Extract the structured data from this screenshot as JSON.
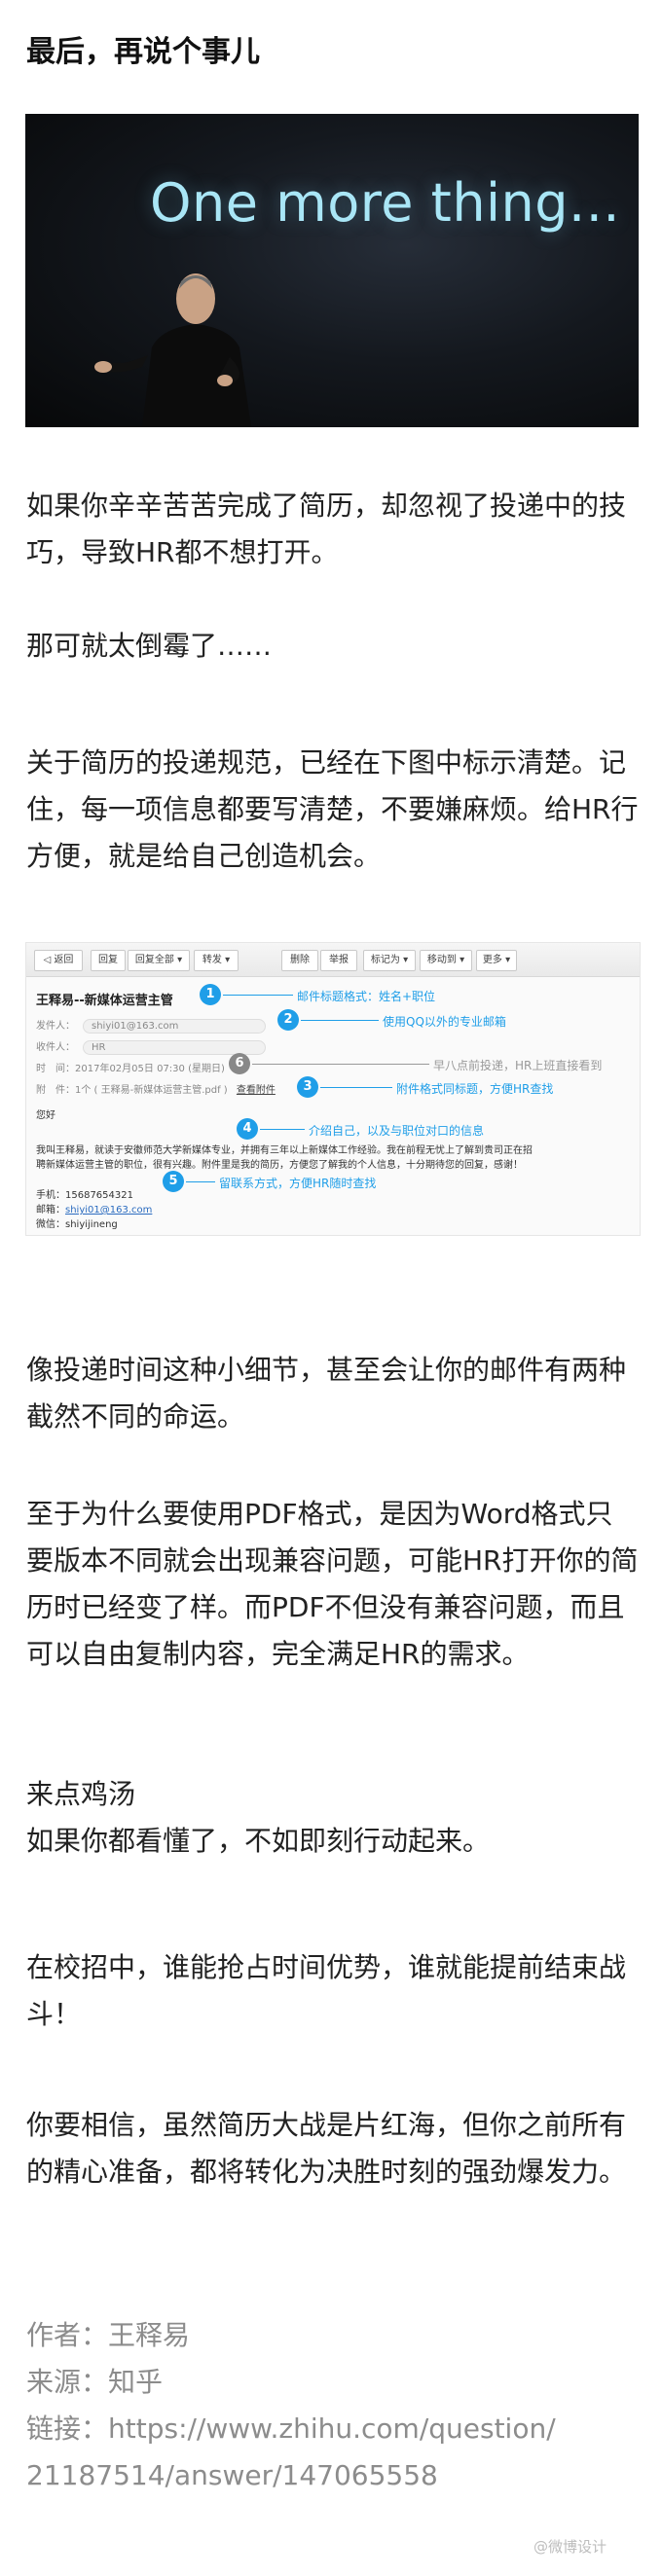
{
  "heading": "最后，再说个事儿",
  "hero": {
    "slide_text": "One more thing..."
  },
  "paragraphs": {
    "p1": "如果你辛辛苦苦完成了简历，却忽视了投递中的技巧，导致HR都不想打开。",
    "p2": "那可就太倒霉了……",
    "p3": "关于简历的投递规范，已经在下图中标示清楚。记住，每一项信息都要写清楚，不要嫌麻烦。给HR行方便，就是给自己创造机会。",
    "p4": "像投递时间这种小细节，甚至会让你的邮件有两种截然不同的命运。",
    "p5": "至于为什么要使用PDF格式，是因为Word格式只要版本不同就会出现兼容问题，可能HR打开你的简历时已经变了样。而PDF不但没有兼容问题，而且可以自由复制内容，完全满足HR的需求。",
    "p6a": "来点鸡汤",
    "p6b": "如果你都看懂了，不如即刻行动起来。",
    "p7": "在校招中，谁能抢占时间优势，谁就能提前结束战斗！",
    "p8": "你要相信，虽然简历大战是片红海，但你之前所有的精心准备，都将转化为决胜时刻的强劲爆发力。"
  },
  "email": {
    "toolbar": [
      "◁ 返回",
      "回复",
      "回复全部 ▾",
      "转发 ▾",
      "删除",
      "举报",
      "标记为 ▾",
      "移动到 ▾",
      "更多 ▾"
    ],
    "subject": "王释易--新媒体运营主管",
    "sender_label": "发件人：",
    "sender_value": "shiyi01@163.com",
    "recipient_label": "收件人：",
    "recipient_value": "HR",
    "time_label": "时　间：",
    "time_value": "2017年02月05日 07:30 (星期日)",
    "attach_label": "附　件：",
    "attach_value": "1个 ( 王释易-新媒体运营主管.pdf )",
    "attach_link": "查看附件",
    "greeting": "您好",
    "body_line1": "我叫王释易，就读于安徽师范大学新媒体专业，并拥有三年以上新媒体工作经验。我在前程无忧上了解到贵司正在招",
    "body_line2": "聘新媒体运营主管的职位，很有兴趣。附件里是我的简历，方便您了解我的个人信息，十分期待您的回复，感谢！",
    "phone": "手机：15687654321",
    "mail_label": "邮箱：",
    "mail_value": "shiyi01@163.com",
    "wechat": "微信：shiyijineng",
    "annotations": [
      {
        "num": "1",
        "text": "邮件标题格式：姓名+职位"
      },
      {
        "num": "2",
        "text": "使用QQ以外的专业邮箱"
      },
      {
        "num": "6",
        "text": "早八点前投递，HR上班直接看到"
      },
      {
        "num": "3",
        "text": "附件格式同标题，方便HR查找"
      },
      {
        "num": "4",
        "text": "介绍自己，以及与职位对口的信息"
      },
      {
        "num": "5",
        "text": "留联系方式，方便HR随时查找"
      }
    ]
  },
  "byline": {
    "author": "作者：王释易",
    "source": "来源：知乎",
    "link1": "链接：https://www.zhihu.com/question/",
    "link2": "21187514/answer/147065558"
  },
  "watermark": "@微博设计"
}
